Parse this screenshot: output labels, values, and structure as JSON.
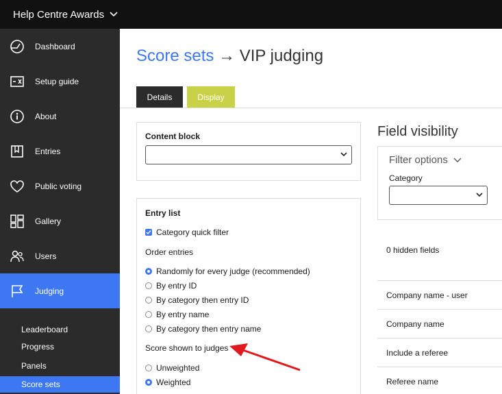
{
  "app": {
    "title": "Help Centre Awards"
  },
  "sidebar": {
    "items": [
      {
        "label": "Dashboard",
        "icon": "dashboard-gauge-icon"
      },
      {
        "label": "Setup guide",
        "icon": "setup-guide-icon"
      },
      {
        "label": "About",
        "icon": "info-icon"
      },
      {
        "label": "Entries",
        "icon": "entries-bookmark-icon"
      },
      {
        "label": "Public voting",
        "icon": "heart-icon"
      },
      {
        "label": "Gallery",
        "icon": "gallery-grid-icon"
      },
      {
        "label": "Users",
        "icon": "users-icon"
      },
      {
        "label": "Judging",
        "icon": "judging-flag-icon",
        "active": true
      }
    ],
    "subitems": [
      {
        "label": "Leaderboard"
      },
      {
        "label": "Progress"
      },
      {
        "label": "Panels"
      },
      {
        "label": "Score sets",
        "active": true
      }
    ]
  },
  "header": {
    "breadcrumb_link": "Score sets",
    "separator": "→",
    "current": "VIP judging"
  },
  "tabs": [
    {
      "label": "Details"
    },
    {
      "label": "Display",
      "active": true
    }
  ],
  "content_block": {
    "title": "Content block",
    "select_value": ""
  },
  "entry_list": {
    "title": "Entry list",
    "category_quick_filter": {
      "label": "Category quick filter",
      "checked": true
    },
    "order_entries": {
      "label": "Order entries",
      "options": [
        {
          "label": "Randomly for every judge (recommended)",
          "selected": true
        },
        {
          "label": "By entry ID",
          "selected": false
        },
        {
          "label": "By category then entry ID",
          "selected": false
        },
        {
          "label": "By entry name",
          "selected": false
        },
        {
          "label": "By category then entry name",
          "selected": false
        }
      ]
    },
    "score_shown": {
      "label": "Score shown to judges",
      "options": [
        {
          "label": "Unweighted",
          "selected": false
        },
        {
          "label": "Weighted",
          "selected": true
        }
      ]
    }
  },
  "field_visibility": {
    "title": "Field visibility",
    "filter_options": "Filter options",
    "category_label": "Category",
    "category_value": "",
    "hidden_count": "0 hidden fields",
    "fields": [
      "Company name - user",
      "Company name",
      "Include a referee",
      "Referee name"
    ]
  },
  "colors": {
    "accent": "#3d78f2",
    "topbar": "#111111",
    "sidebar": "#2b2b2b",
    "display_tab": "#c9d146",
    "annotation_arrow": "#e0191c"
  }
}
